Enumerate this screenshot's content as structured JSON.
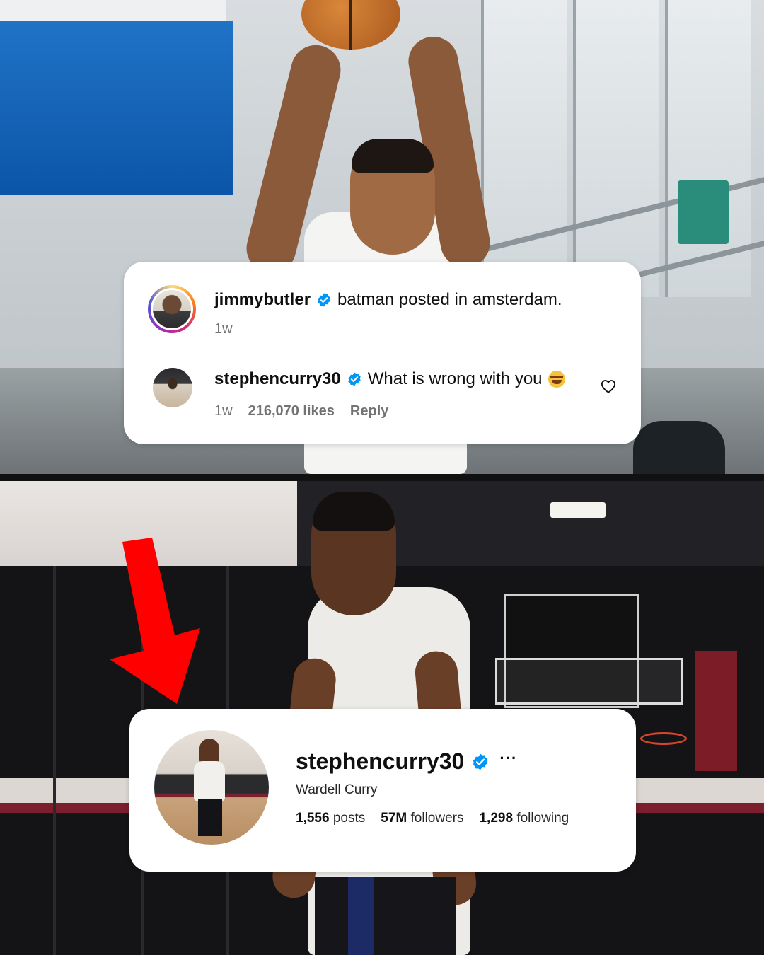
{
  "comment_card": {
    "comments": [
      {
        "username": "jimmybutler",
        "text": "batman posted in amsterdam.",
        "time": "1w"
      },
      {
        "username": "stephencurry30",
        "text": "What is wrong with you",
        "time": "1w",
        "likes": "216,070 likes",
        "reply_label": "Reply"
      }
    ]
  },
  "profile_card": {
    "username": "stephencurry30",
    "more_label": "···",
    "full_name": "Wardell Curry",
    "posts_count": "1,556",
    "posts_label": "posts",
    "followers_count": "57M",
    "followers_label": "followers",
    "following_count": "1,298",
    "following_label": "following"
  },
  "colors": {
    "verified_blue": "#0095f6",
    "arrow_red": "#ff0000",
    "card_bg": "#ffffff",
    "muted_text": "#737373"
  },
  "icons": [
    "verified-badge-icon",
    "heart-icon",
    "laughing-emoji-icon",
    "red-arrow-icon"
  ]
}
